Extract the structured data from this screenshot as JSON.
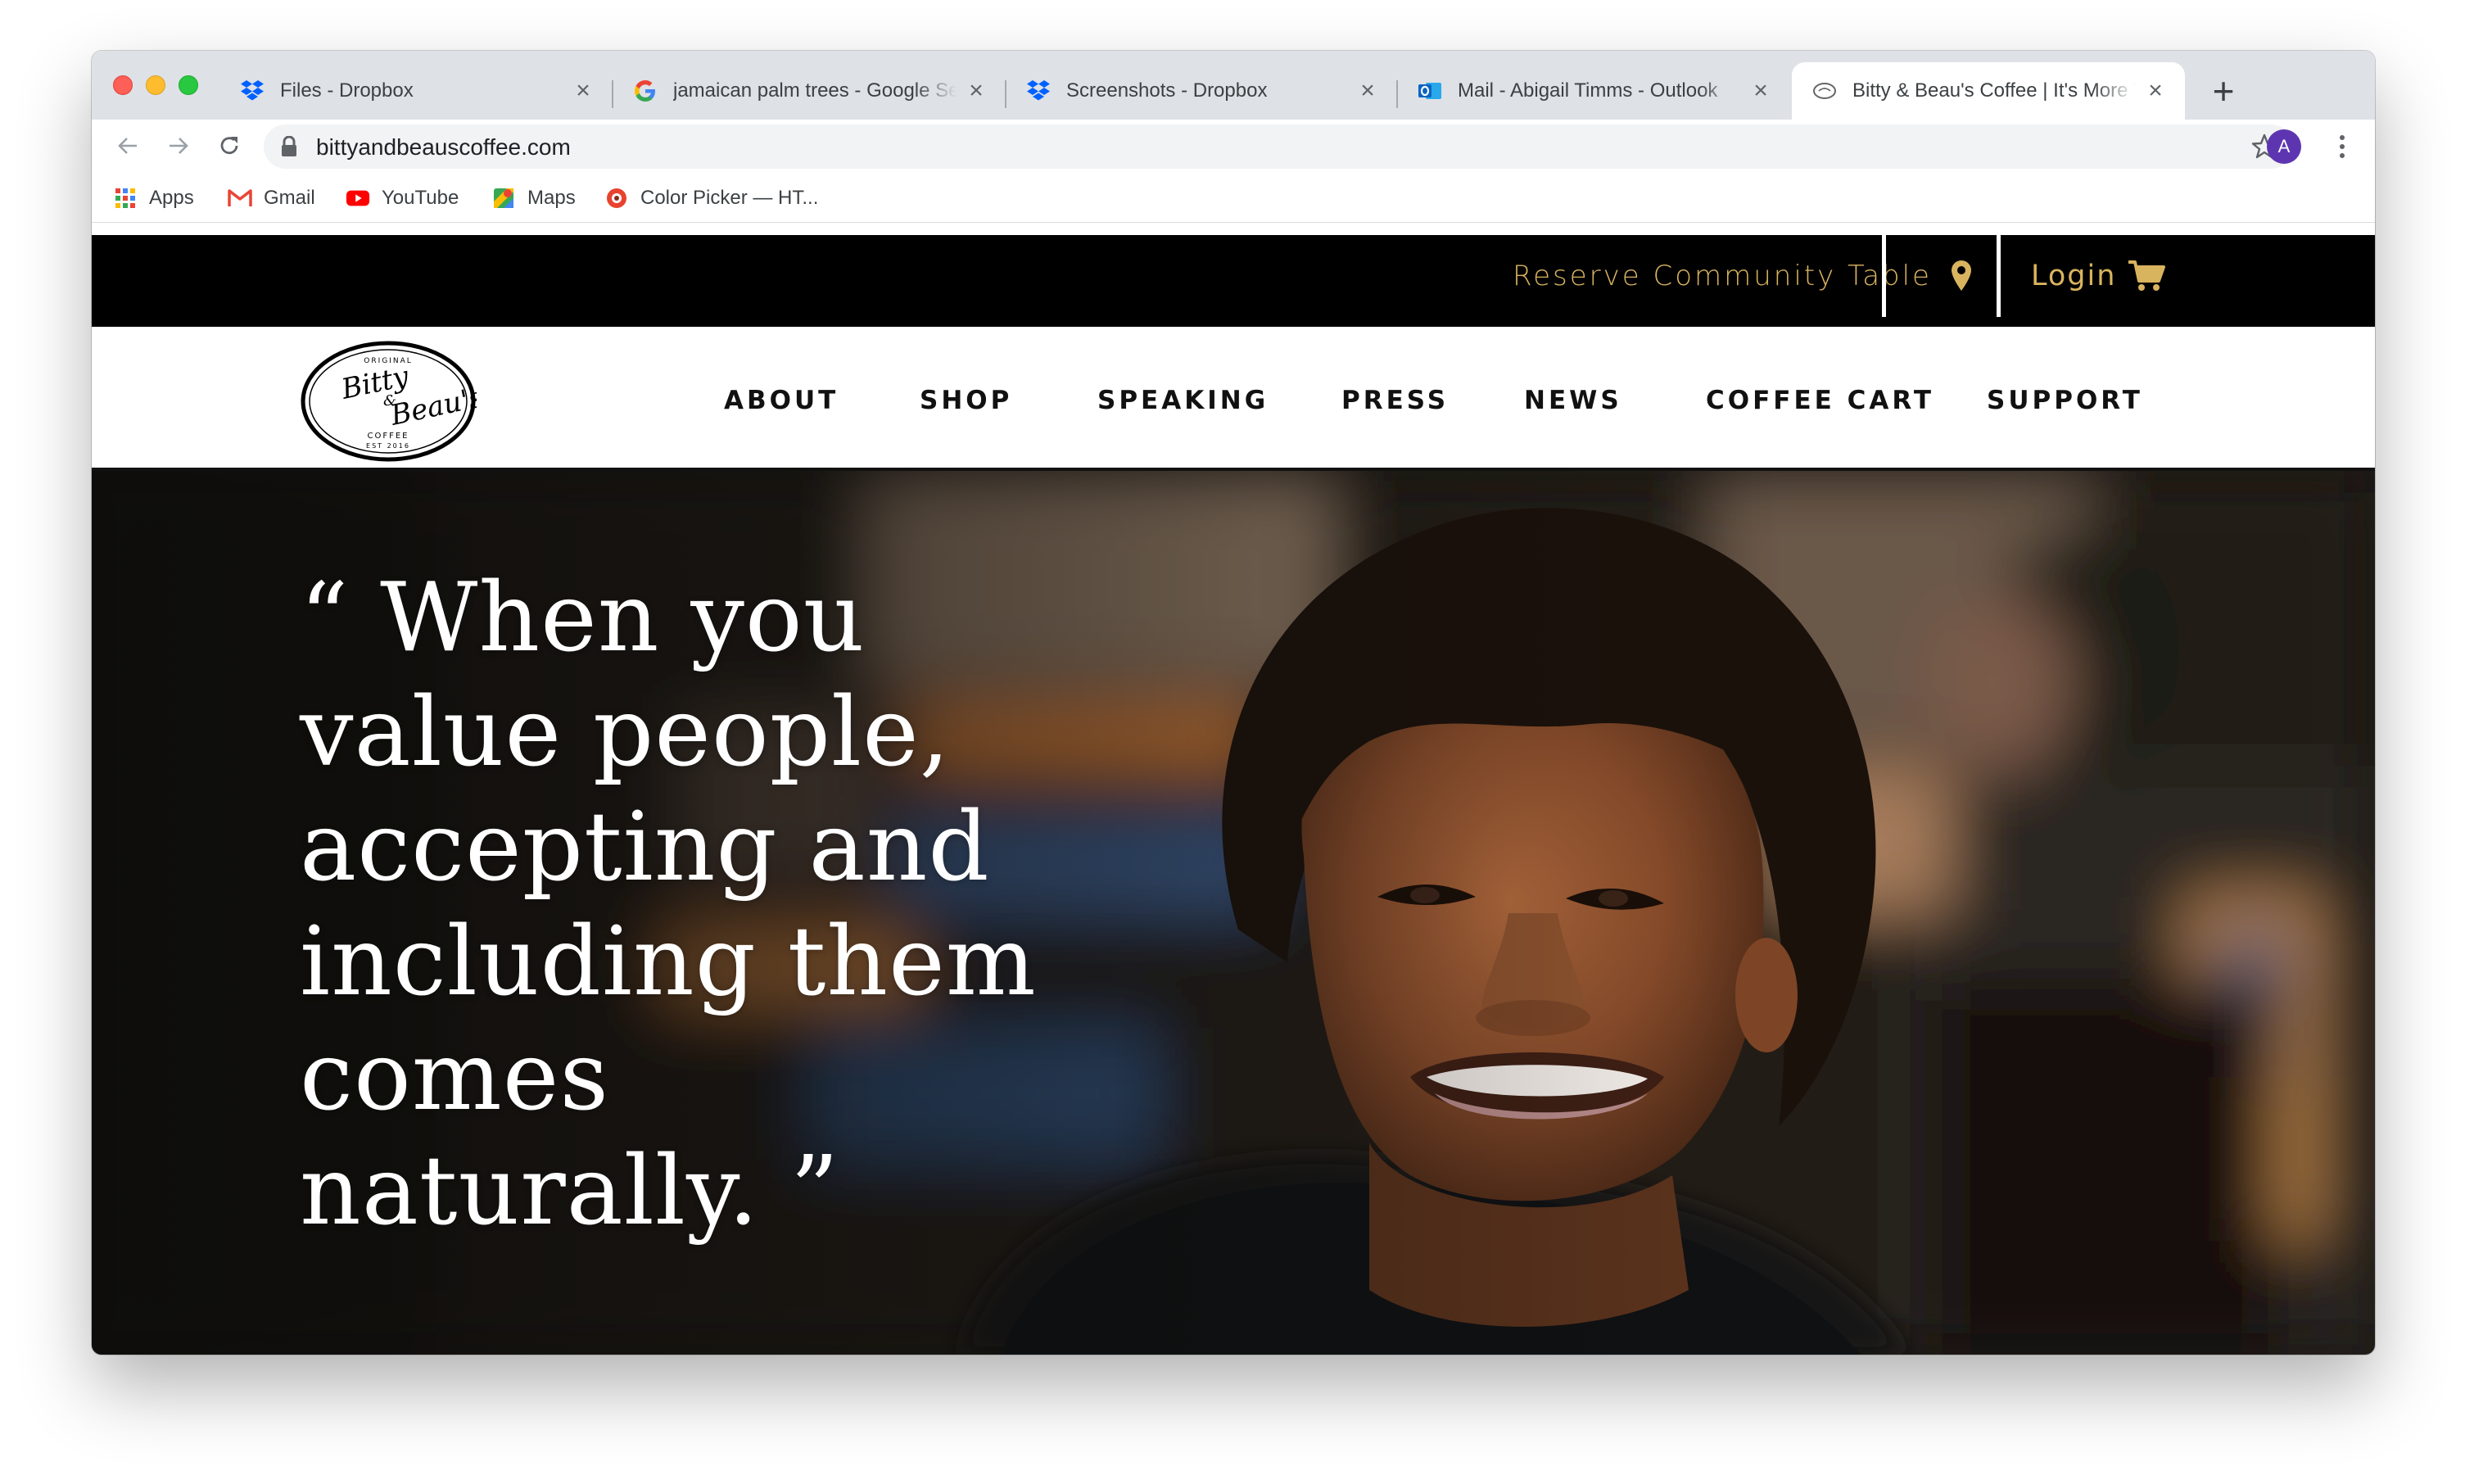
{
  "browser": {
    "tabs": [
      {
        "title": "Files - Dropbox",
        "icon": "dropbox-icon",
        "active": false
      },
      {
        "title": "jamaican palm trees - Google Search",
        "icon": "google-icon",
        "active": false
      },
      {
        "title": "Screenshots - Dropbox",
        "icon": "dropbox-icon",
        "active": false
      },
      {
        "title": "Mail - Abigail Timms - Outlook",
        "icon": "outlook-icon",
        "active": false
      },
      {
        "title": "Bitty & Beau's Coffee | It's More Than Coffee",
        "icon": "site-favicon",
        "active": true
      }
    ],
    "new_tab_label": "+",
    "url": "bittyandbeauscoffee.com",
    "profile_initial": "A",
    "bookmarks": [
      {
        "label": "Apps",
        "icon": "apps-grid-icon"
      },
      {
        "label": "Gmail",
        "icon": "gmail-icon"
      },
      {
        "label": "YouTube",
        "icon": "youtube-icon"
      },
      {
        "label": "Maps",
        "icon": "maps-icon"
      },
      {
        "label": "Color Picker — HT...",
        "icon": "color-picker-icon"
      }
    ]
  },
  "site": {
    "topbar": {
      "reserve_label": "Reserve Community Table",
      "login_label": "Login"
    },
    "logo": {
      "top_text": "ORIGINAL",
      "name_line1": "Bitty",
      "name_amp": "&",
      "name_line2": "Beau's",
      "sub_text": "COFFEE",
      "est_text": "EST 2016"
    },
    "nav": [
      {
        "label": "ABOUT"
      },
      {
        "label": "SHOP"
      },
      {
        "label": "SPEAKING"
      },
      {
        "label": "PRESS"
      },
      {
        "label": "NEWS"
      },
      {
        "label": "COFFEE CART"
      },
      {
        "label": "SUPPORT"
      }
    ],
    "hero": {
      "quote_lines": [
        "“ When you",
        "value people,",
        "accepting and",
        "including them",
        "comes",
        "naturally. ”"
      ]
    }
  },
  "colors": {
    "accent_gold": "#d9b45e",
    "topbar_bg": "#000000",
    "tabstrip_bg": "#dee1e6"
  }
}
